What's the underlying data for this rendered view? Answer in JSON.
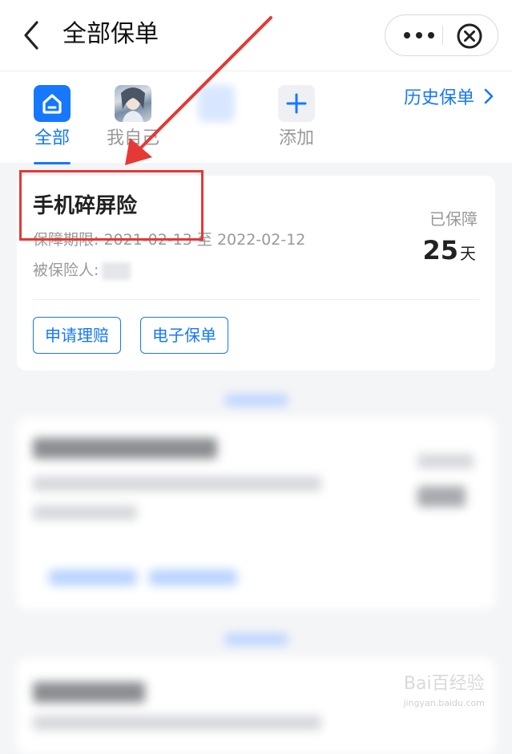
{
  "navbar": {
    "title": "全部保单",
    "back_icon": "chevron-left-icon",
    "more_icon": "more-dots-icon",
    "close_icon": "close-circle-icon"
  },
  "tabs": {
    "items": [
      {
        "label": "全部",
        "icon": "home-icon",
        "active": true
      },
      {
        "label": "我自己",
        "icon": "avatar-image",
        "active": false
      },
      {
        "label": "",
        "icon": "blurred-icon",
        "active": false
      },
      {
        "label": "添加",
        "icon": "plus-icon",
        "active": false
      }
    ],
    "history_link": "历史保单",
    "history_icon": "chevron-right-icon"
  },
  "policy_card": {
    "name": "手机碎屏险",
    "period_label": "保障期限:",
    "period_value": "2021-02-13 至 2022-02-12",
    "insured_label": "被保险人:",
    "status_label": "已保障",
    "days": "25",
    "days_unit": "天",
    "buttons": {
      "claim": "申请理赔",
      "epolicy": "电子保单"
    }
  },
  "watermark": {
    "main": "Bai百经验",
    "sub": "jingyan.baidu.com"
  },
  "colors": {
    "accent": "#1677ff",
    "annotation": "#e53935",
    "background": "#f4f5f7"
  }
}
